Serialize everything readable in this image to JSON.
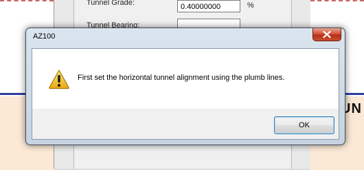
{
  "background": {
    "field_label_top": "Tunnel Grade:",
    "field_label_second": "Tunnel Bearing:",
    "grade_value": "0.40000000",
    "grade_unit": "%",
    "partial_heading": "UN"
  },
  "dialog": {
    "title": "AZ100",
    "message": "First set the horizontal tunnel alignment using the plumb lines.",
    "ok_label": "OK",
    "icon": "warning-icon",
    "close_icon": "close-icon"
  },
  "colors": {
    "close_button": "#c9502f",
    "warning": "#f2c230",
    "accent_line": "#2e3f9c"
  }
}
